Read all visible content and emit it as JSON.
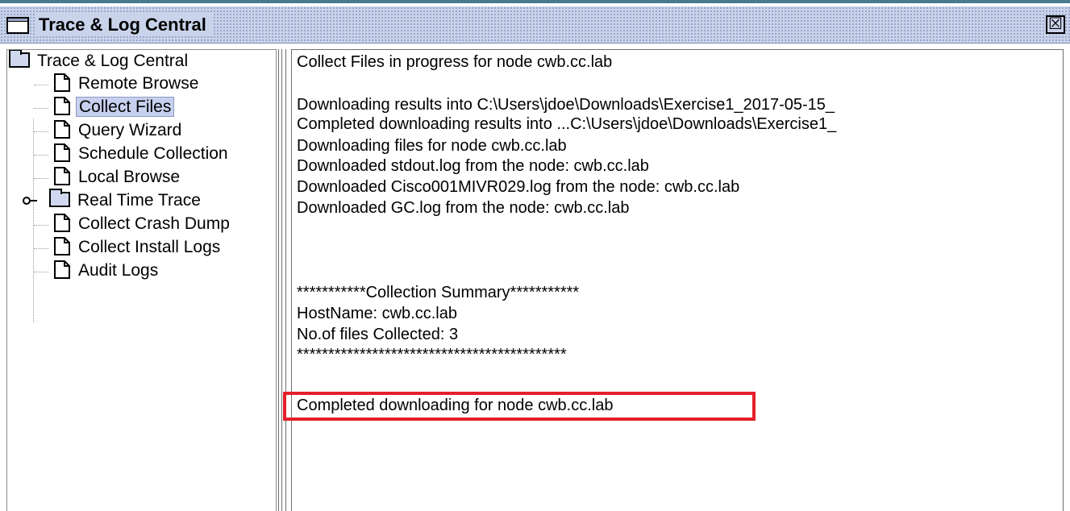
{
  "window": {
    "title": "Trace & Log Central",
    "close_glyph": "☒",
    "icons": {
      "title": "window-icon",
      "close": "close-icon"
    }
  },
  "tree": {
    "root_label": "Trace & Log Central",
    "items": [
      {
        "label": "Remote Browse",
        "icon": "file-icon"
      },
      {
        "label": "Collect Files",
        "icon": "file-icon",
        "selected": true
      },
      {
        "label": "Query Wizard",
        "icon": "file-icon"
      },
      {
        "label": "Schedule Collection",
        "icon": "file-icon"
      },
      {
        "label": "Local Browse",
        "icon": "file-icon"
      },
      {
        "label": "Real Time Trace",
        "icon": "folder-icon",
        "collapsed": true
      },
      {
        "label": "Collect Crash Dump",
        "icon": "file-icon"
      },
      {
        "label": "Collect Install Logs",
        "icon": "file-icon"
      },
      {
        "label": "Audit Logs",
        "icon": "file-icon"
      }
    ]
  },
  "log": {
    "lines": [
      "Collect Files in progress for node cwb.cc.lab",
      "",
      "Downloading results into C:\\Users\\jdoe\\Downloads\\Exercise1_2017-05-15_",
      "Completed downloading results into ...C:\\Users\\jdoe\\Downloads\\Exercise1_",
      "Downloading files for node cwb.cc.lab",
      "Downloaded stdout.log from the node: cwb.cc.lab",
      "Downloaded Cisco001MIVR029.log from the node: cwb.cc.lab",
      "Downloaded GC.log from the node: cwb.cc.lab",
      "",
      "",
      "",
      "***********Collection Summary***********",
      "HostName: cwb.cc.lab",
      "No.of files Collected: 3",
      "*******************************************",
      "",
      "",
      "Completed downloading for node cwb.cc.lab"
    ],
    "highlight_color": "#e3202a"
  }
}
